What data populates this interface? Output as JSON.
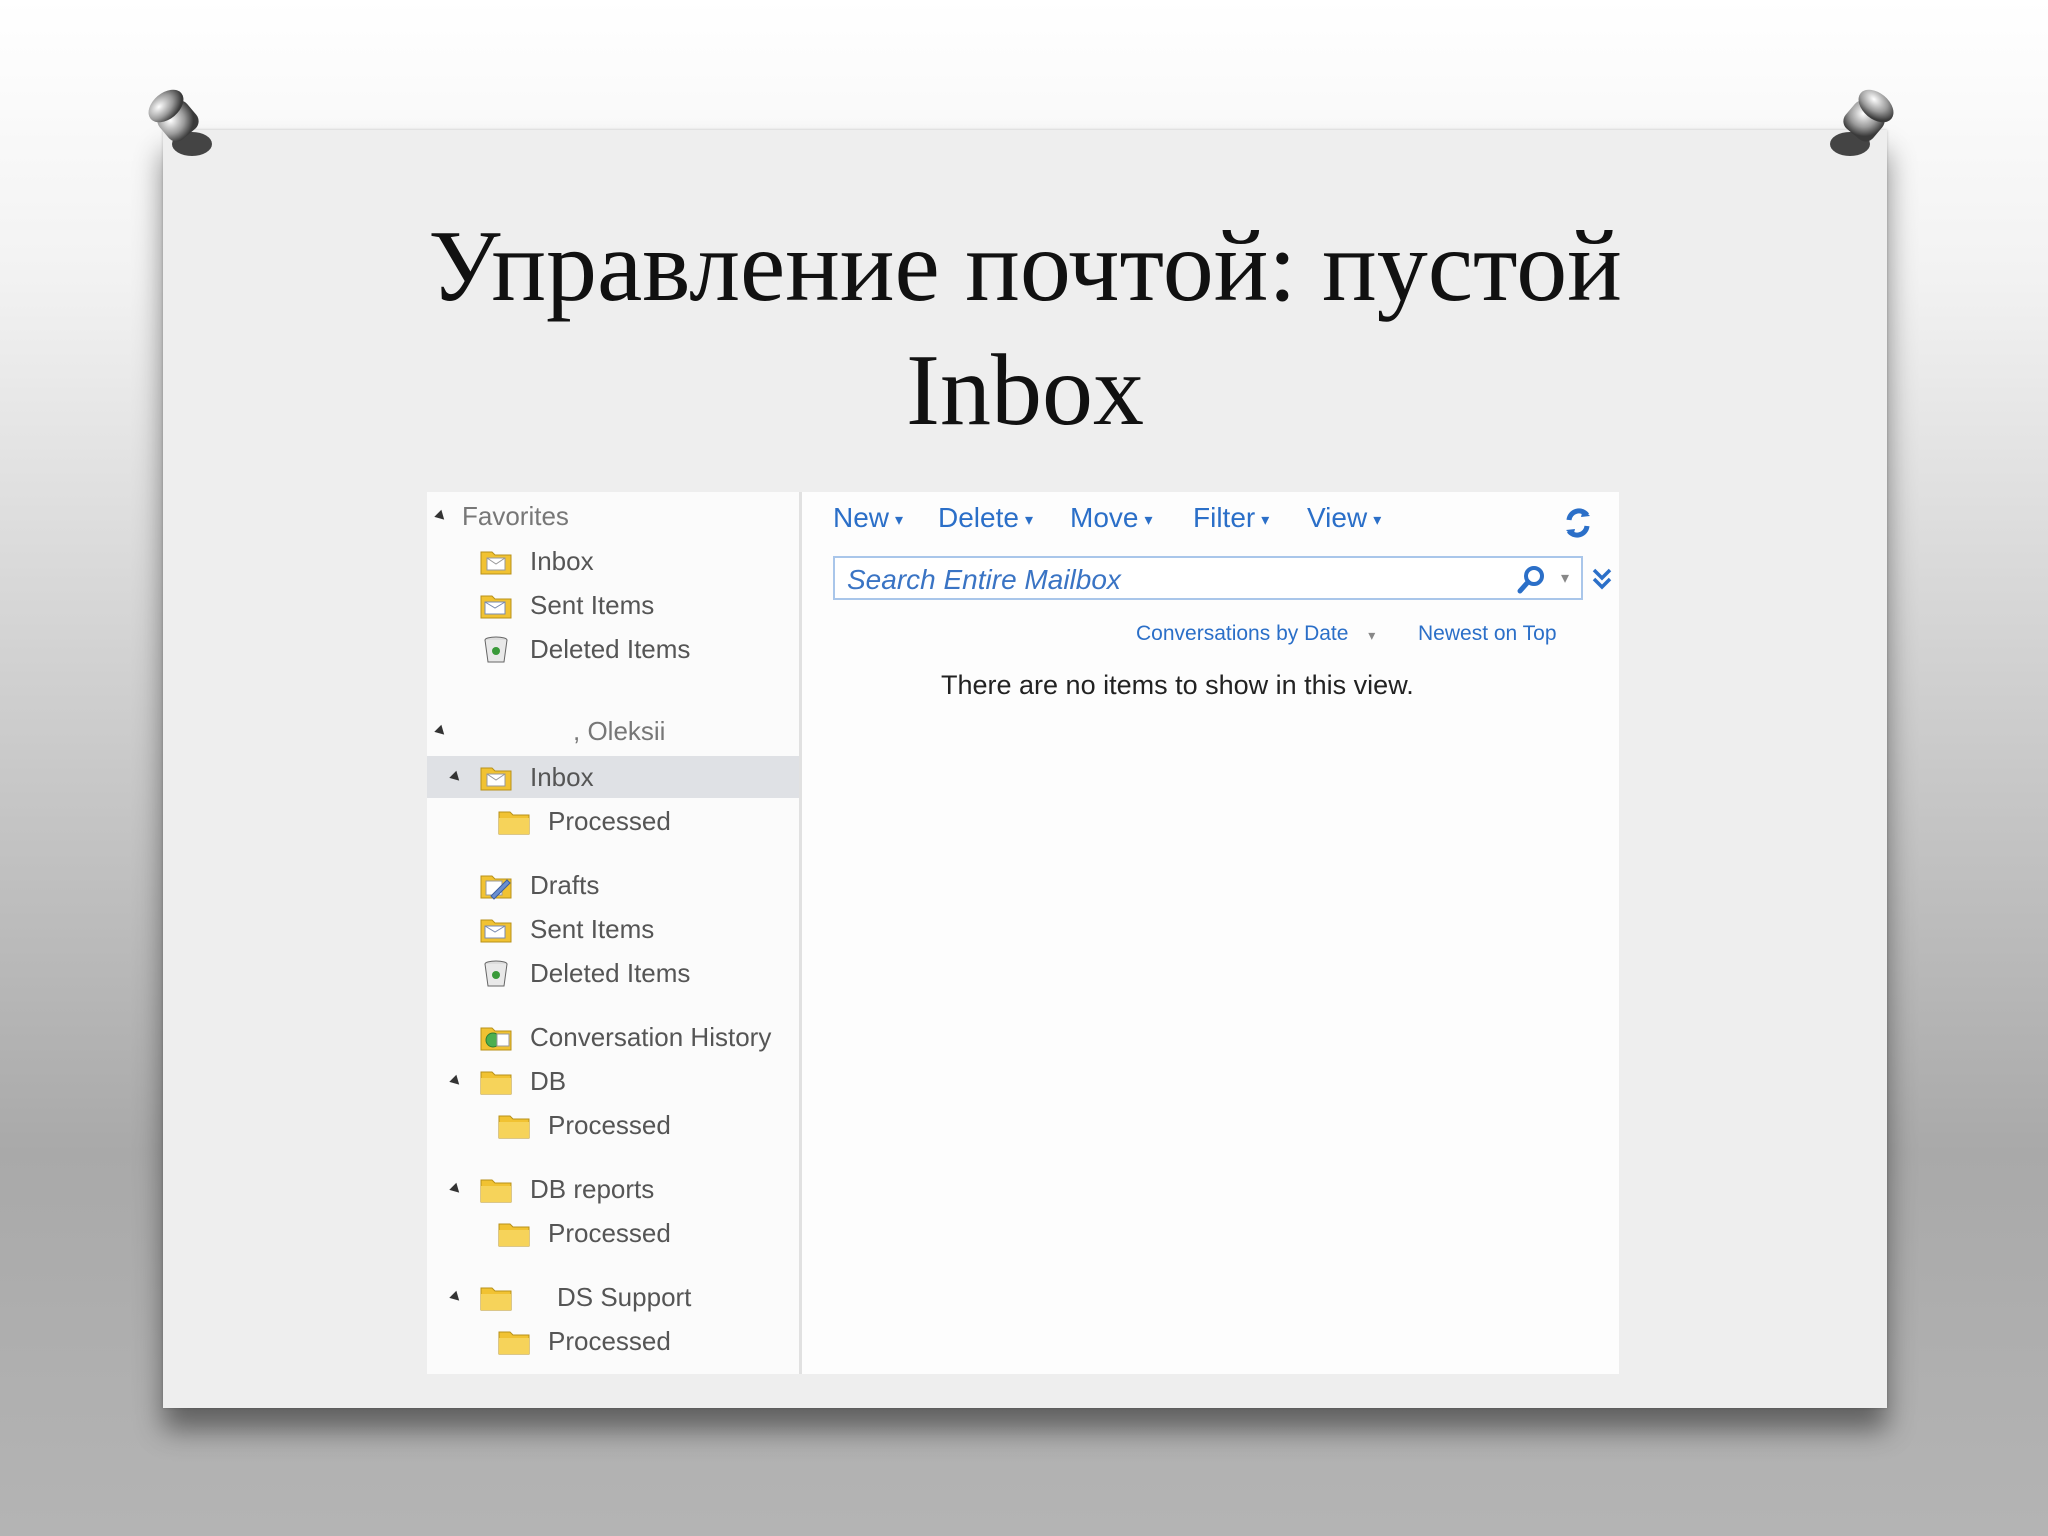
{
  "slide": {
    "title_line1": "Управление почтой: пустой",
    "title_line2": "Inbox"
  },
  "nav": {
    "favorites_header": "Favorites",
    "favorites": [
      {
        "label": "Inbox",
        "icon": "inbox-folder-icon"
      },
      {
        "label": "Sent Items",
        "icon": "sent-folder-icon"
      },
      {
        "label": "Deleted Items",
        "icon": "trash-icon"
      }
    ],
    "mailbox_header": ", Oleksii",
    "mailbox_items": [
      {
        "label": "Inbox",
        "icon": "inbox-folder-icon",
        "expanded": true,
        "selected": true
      },
      {
        "label": "Processed",
        "icon": "folder-icon"
      },
      {
        "label": "Drafts",
        "icon": "drafts-folder-icon"
      },
      {
        "label": "Sent Items",
        "icon": "sent-folder-icon"
      },
      {
        "label": "Deleted Items",
        "icon": "trash-icon"
      },
      {
        "label": "Conversation History",
        "icon": "conversation-history-folder-icon"
      },
      {
        "label": "DB",
        "icon": "folder-icon",
        "expanded": true
      },
      {
        "label": "Processed",
        "icon": "folder-icon"
      },
      {
        "label": "DB reports",
        "icon": "folder-icon",
        "expanded": true
      },
      {
        "label": "Processed",
        "icon": "folder-icon"
      },
      {
        "label": "DS Support",
        "icon": "folder-icon",
        "expanded": true
      },
      {
        "label": "Processed",
        "icon": "folder-icon"
      }
    ]
  },
  "toolbar": {
    "new": "New",
    "delete": "Delete",
    "move": "Move",
    "filter": "Filter",
    "view": "View"
  },
  "search": {
    "placeholder": "Search Entire Mailbox"
  },
  "list": {
    "sort_by": "Conversations by Date",
    "sort_order": "Newest on Top",
    "empty_message": "There are no items to show in this view."
  },
  "colors": {
    "link_blue": "#2b6fc8",
    "selected_row": "#dfe1e5",
    "folder_yellow": "#f1c232"
  }
}
